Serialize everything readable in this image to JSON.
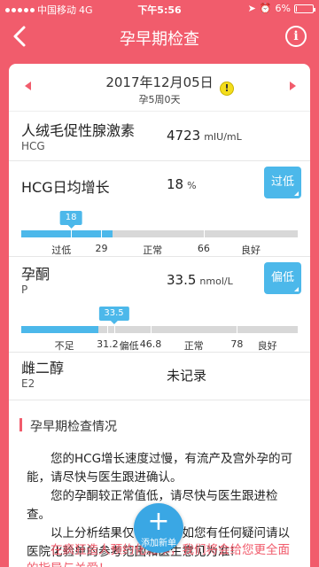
{
  "statusbar": {
    "carrier": "中国移动",
    "network": "4G",
    "time": "下午5:56",
    "battery": "6%",
    "battery_level": 0.06
  },
  "navbar": {
    "back_icon": "chevron-left-icon",
    "title": "孕早期检查",
    "info_label": "i"
  },
  "date_bar": {
    "date": "2017年12月05日",
    "pregnancy_week": "孕5周0天",
    "warn_label": "!"
  },
  "items": {
    "hcg": {
      "name": "人绒毛促性腺激素",
      "abbr": "HCG",
      "value": "4723",
      "unit": "mIU/mL"
    },
    "hcg_daily": {
      "name": "HCG日均增长",
      "value": "18",
      "unit": "%",
      "status": "过低",
      "gauge": {
        "value_label": "18",
        "value": 18,
        "min": 0,
        "max": 100,
        "thresholds": [
          29,
          66
        ],
        "labels": [
          "过低",
          "29",
          "正常",
          "66",
          "良好"
        ]
      }
    },
    "progesterone": {
      "name": "孕酮",
      "abbr": "P",
      "value": "33.5",
      "unit": "nmol/L",
      "status": "偏低",
      "gauge": {
        "value_label": "33.5",
        "value": 33.5,
        "min": 0,
        "max": 100,
        "thresholds": [
          31.2,
          46.8,
          78
        ],
        "labels": [
          "不足",
          "31.2",
          "偏低",
          "46.8",
          "正常",
          "78",
          "良好"
        ]
      }
    },
    "estradiol": {
      "name": "雌二醇",
      "abbr": "E2",
      "value": "未记录"
    }
  },
  "section": {
    "title": "孕早期检查情况",
    "paragraphs": [
      "您的HCG增长速度过慢，有流产及宫外孕的可能，请尽快与医生跟进确认。",
      "您的孕酮较正常值低，请尽快与医生跟进检查。",
      "以上分析结果仅供参考，如您有任何疑问请以医院化验单的参考范围和医生意见为准!"
    ],
    "promo": "在疯狂造人预约化验单，我们将会给您更全面的指导与关爱！"
  },
  "fab": {
    "plus": "+",
    "label": "添加新单"
  },
  "colors": {
    "brand": "#f15c6c",
    "accent": "#4cb8ea",
    "track": "#d8d8d8"
  }
}
